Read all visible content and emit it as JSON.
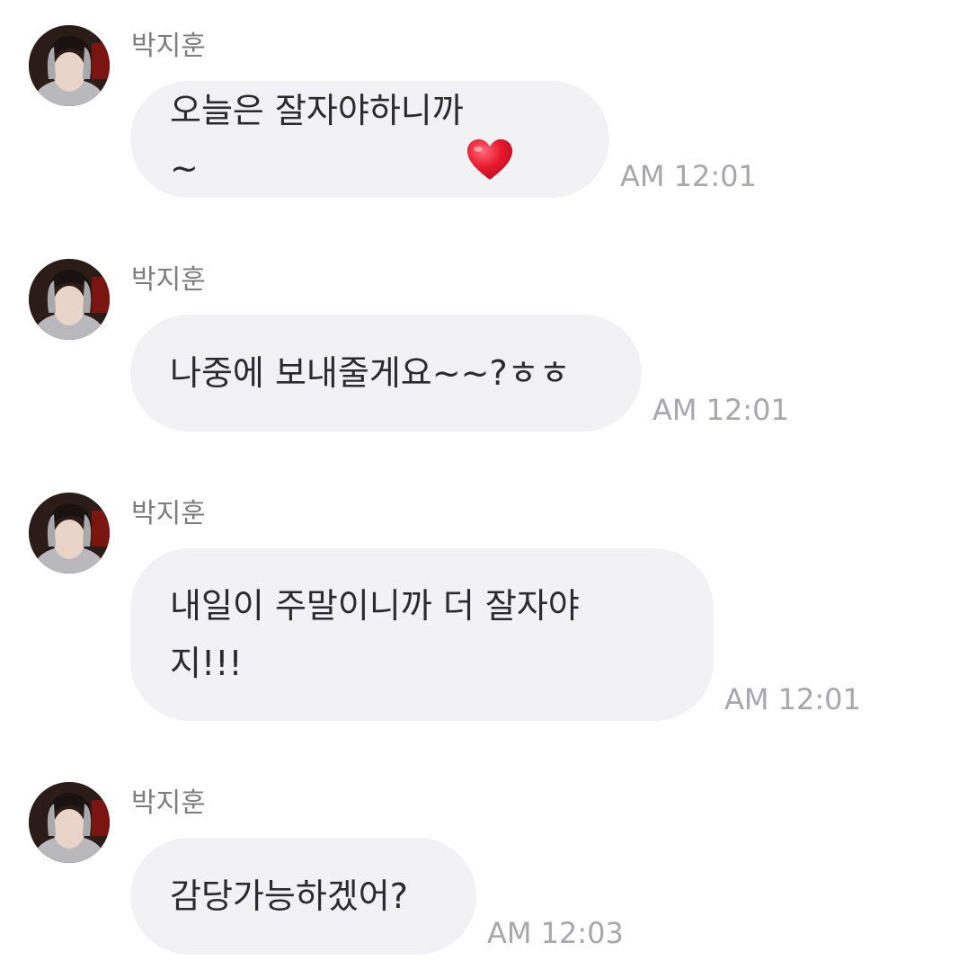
{
  "chat": {
    "messages": [
      {
        "sender": "박지훈",
        "text": "오늘은 잘자야하니까~",
        "emoji": "heart-emoji",
        "time": "AM 12:01"
      },
      {
        "sender": "박지훈",
        "text": "나중에 보내줄게요~~?ㅎㅎ",
        "time": "AM 12:01"
      },
      {
        "sender": "박지훈",
        "text": "내일이 주말이니까 더 잘자야\n지!!!",
        "time": "AM 12:01"
      },
      {
        "sender": "박지훈",
        "text": "감당가능하겠어?",
        "time": "AM 12:03"
      }
    ]
  },
  "colors": {
    "bubble": "#f2f2f5",
    "message_text": "#2b2b2f",
    "sender_text": "#7d7d7d",
    "timestamp": "#a7a7ad",
    "heart": "#e0182d"
  }
}
